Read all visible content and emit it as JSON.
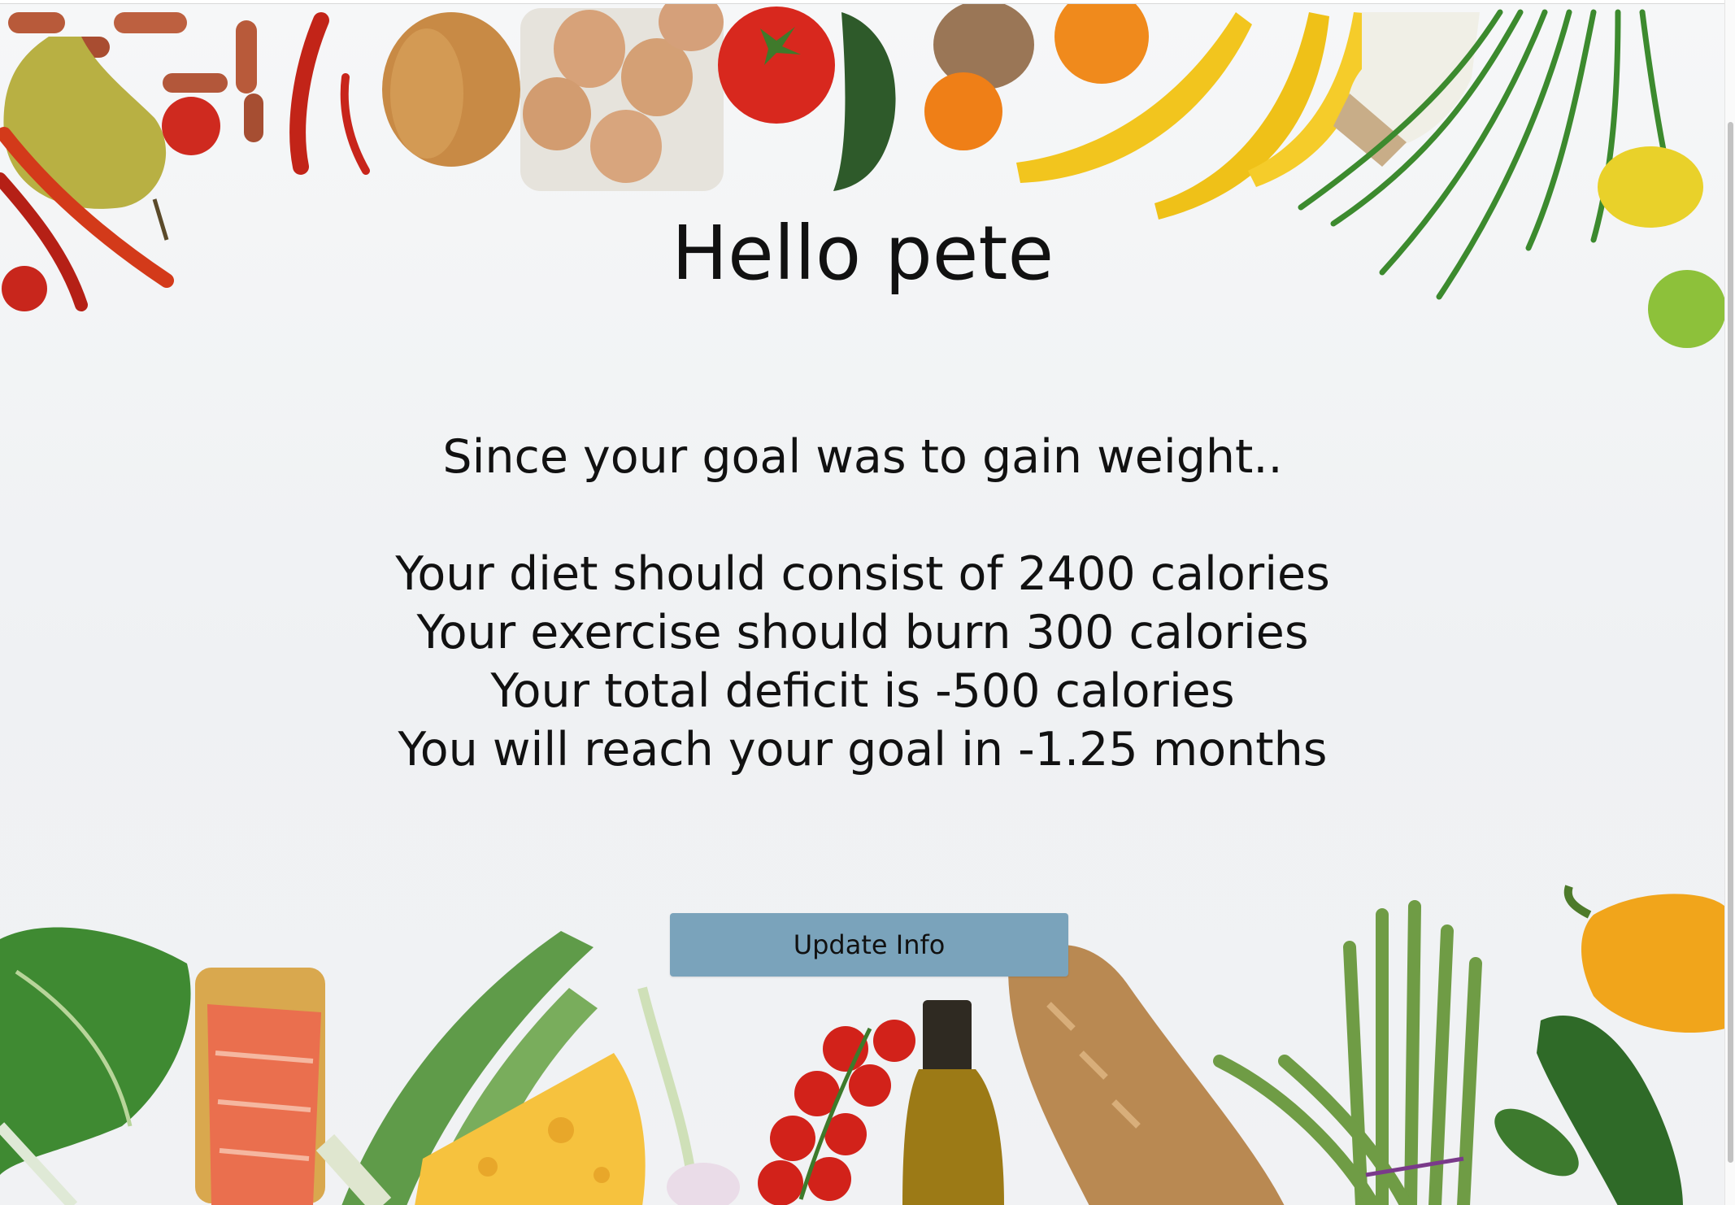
{
  "greeting": "Hello pete",
  "intro": "Since your goal was to gain weight..",
  "stats": [
    "Your diet should consist of 2400 calories",
    "Your exercise should burn 300 calories",
    "Your total deficit is -500 calories",
    "You will reach your goal in -1.25 months"
  ],
  "button": {
    "label": "Update Info"
  },
  "colors": {
    "button_bg": "#7aa3bb",
    "text": "#111111",
    "background": "#f3f4f6"
  },
  "background_image": {
    "icon": "groceries-border-photo",
    "items": [
      "sausages",
      "pear",
      "chili-peppers",
      "cherry-tomato",
      "croissant",
      "eggs-carton",
      "tomato",
      "zucchini",
      "bread-roll",
      "tangerines",
      "bananas",
      "milk-bottle",
      "green-onions",
      "lemon",
      "lime",
      "spinach",
      "salmon",
      "leek",
      "cheese",
      "garlic",
      "cherry-tomatoes",
      "olive-oil",
      "baguette",
      "asparagus",
      "yellow-pepper",
      "cucumber"
    ]
  }
}
